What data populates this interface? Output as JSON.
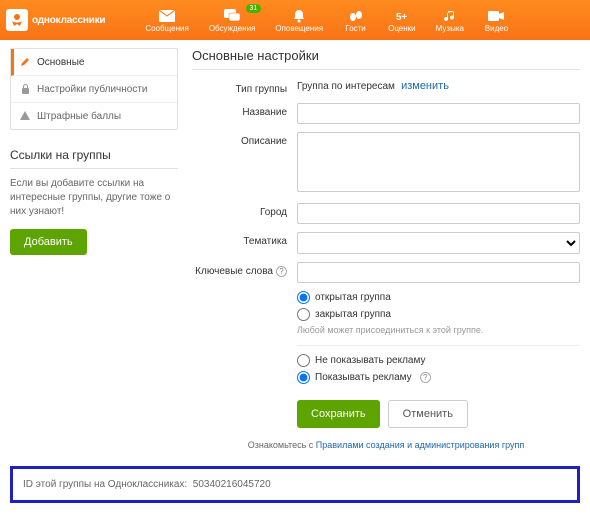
{
  "brand": {
    "name": "одноклассники"
  },
  "nav": {
    "items": [
      {
        "label": "Сообщения"
      },
      {
        "label": "Обсуждения",
        "badge": "31"
      },
      {
        "label": "Оповещения"
      },
      {
        "label": "Гости"
      },
      {
        "label": "Оценки"
      },
      {
        "label": "Музыка"
      },
      {
        "label": "Видео"
      }
    ]
  },
  "sidebar": {
    "menu": [
      {
        "label": "Основные",
        "active": true
      },
      {
        "label": "Настройки публичности"
      },
      {
        "label": "Штрафные баллы"
      }
    ],
    "links_title": "Ссылки на группы",
    "links_desc": "Если вы добавите ссылки на интересные группы, другие тоже о них узнают!",
    "add_button": "Добавить"
  },
  "main": {
    "title": "Основные настройки",
    "labels": {
      "group_type": "Тип группы",
      "name": "Название",
      "description": "Описание",
      "city": "Город",
      "theme": "Тематика",
      "keywords": "Ключевые слова"
    },
    "group_type_value": "Группа по интересам",
    "change_link": "изменить",
    "fields": {
      "name": "",
      "description": "",
      "city": "",
      "theme": "",
      "keywords": ""
    },
    "access": {
      "open": "открытая группа",
      "closed": "закрытая группа",
      "selected": "open",
      "hint": "Любой может присоединиться к этой группе."
    },
    "ads": {
      "hide": "Не показывать рекламу",
      "show": "Показывать рекламу",
      "selected": "show"
    },
    "save": "Сохранить",
    "cancel": "Отменить",
    "rules_prefix": "Ознакомьтесь с ",
    "rules_link": "Правилами создания и администрирования групп"
  },
  "idbox": {
    "label": "ID этой группы на Одноклассниках:",
    "value": "50340216045720"
  }
}
